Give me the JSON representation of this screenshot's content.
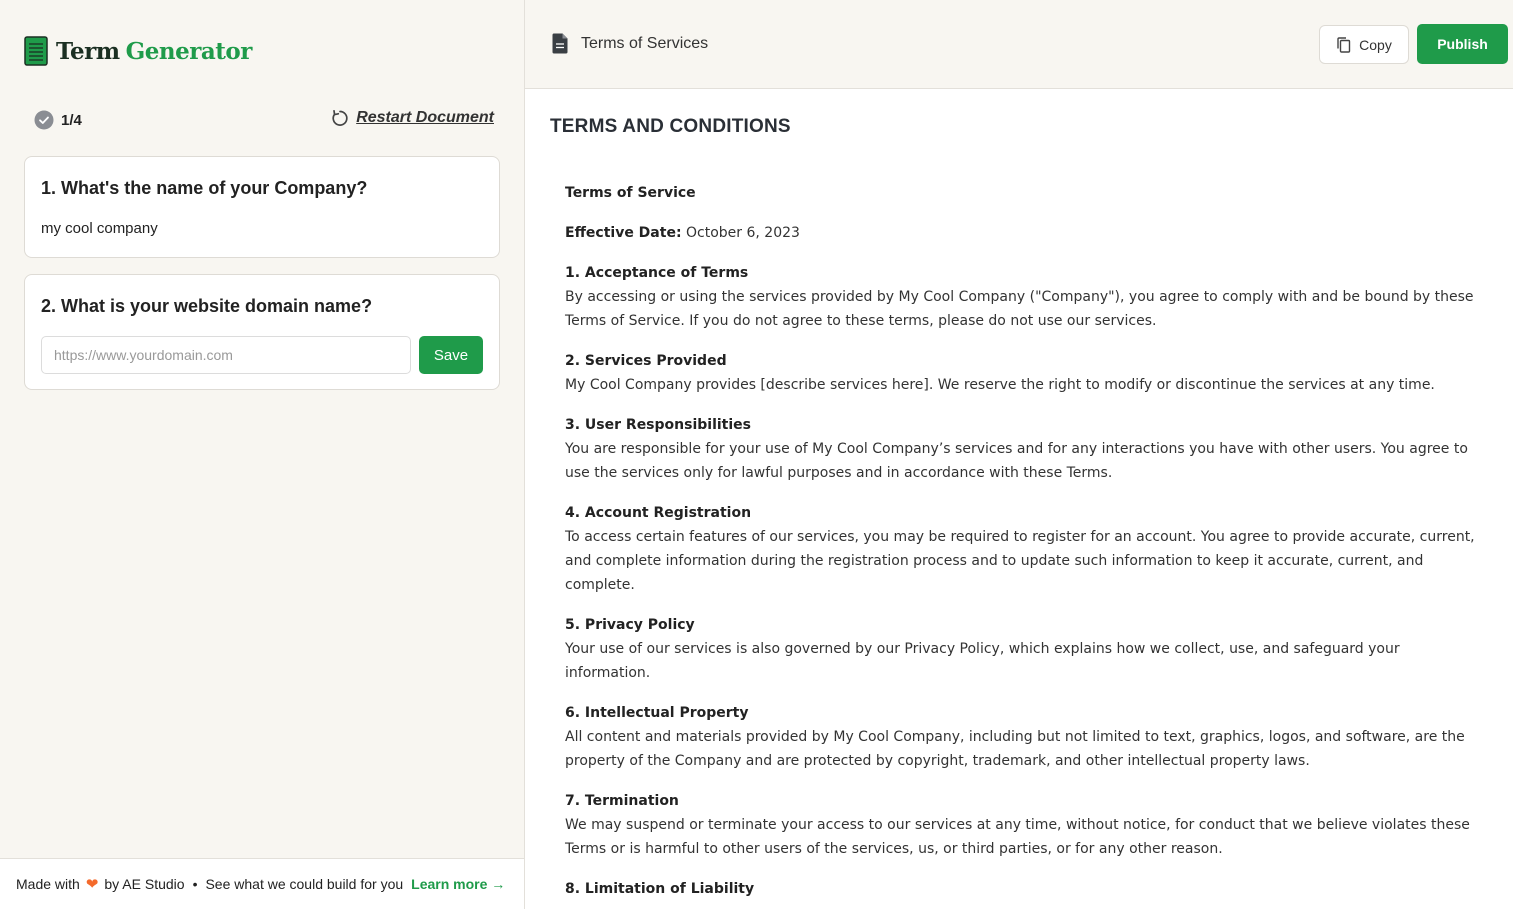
{
  "app": {
    "logo_term": "Term",
    "logo_generator": "Generator"
  },
  "progress": {
    "step": "1/4",
    "restart_label": "Restart Document"
  },
  "questions": [
    {
      "title": "1. What's the name of your Company?",
      "answer": "my cool company"
    },
    {
      "title": "2. What is your website domain name?",
      "input_value": "",
      "placeholder": "https://www.yourdomain.com",
      "save_label": "Save"
    }
  ],
  "footer": {
    "made_with": "Made with",
    "by": "by AE Studio",
    "separator": "•",
    "pitch": "See what we could build for you",
    "learn_more": "Learn more →"
  },
  "document": {
    "tab_title": "Terms of Services",
    "copy_label": "Copy",
    "publish_label": "Publish",
    "heading": "TERMS AND CONDITIONS",
    "intro_title": "Terms of Service",
    "effective_label": "Effective Date:",
    "effective_value": " October 6, 2023",
    "sections": [
      {
        "title": "1. Acceptance of Terms",
        "text": "By accessing or using the services provided by My Cool Company (\"Company\"), you agree to comply with and be bound by these Terms of Service. If you do not agree to these terms, please do not use our services."
      },
      {
        "title": "2. Services Provided",
        "text": "My Cool Company provides [describe services here]. We reserve the right to modify or discontinue the services at any time."
      },
      {
        "title": "3. User Responsibilities",
        "text": "You are responsible for your use of My Cool Company’s services and for any interactions you have with other users. You agree to use the services only for lawful purposes and in accordance with these Terms."
      },
      {
        "title": "4. Account Registration",
        "text": "To access certain features of our services, you may be required to register for an account. You agree to provide accurate, current, and complete information during the registration process and to update such information to keep it accurate, current, and complete."
      },
      {
        "title": "5. Privacy Policy",
        "text": "Your use of our services is also governed by our Privacy Policy, which explains how we collect, use, and safeguard your information."
      },
      {
        "title": "6. Intellectual Property",
        "text": "All content and materials provided by My Cool Company, including but not limited to text, graphics, logos, and software, are the property of the Company and are protected by copyright, trademark, and other intellectual property laws."
      },
      {
        "title": "7. Termination",
        "text": "We may suspend or terminate your access to our services at any time, without notice, for conduct that we believe violates these Terms or is harmful to other users of the services, us, or third parties, or for any other reason."
      },
      {
        "title": "8. Limitation of Liability",
        "text": ""
      }
    ]
  },
  "colors": {
    "brand_green": "#1f9b4a",
    "panel_bg": "#f8f6f1",
    "heart": "#f46a2b"
  }
}
